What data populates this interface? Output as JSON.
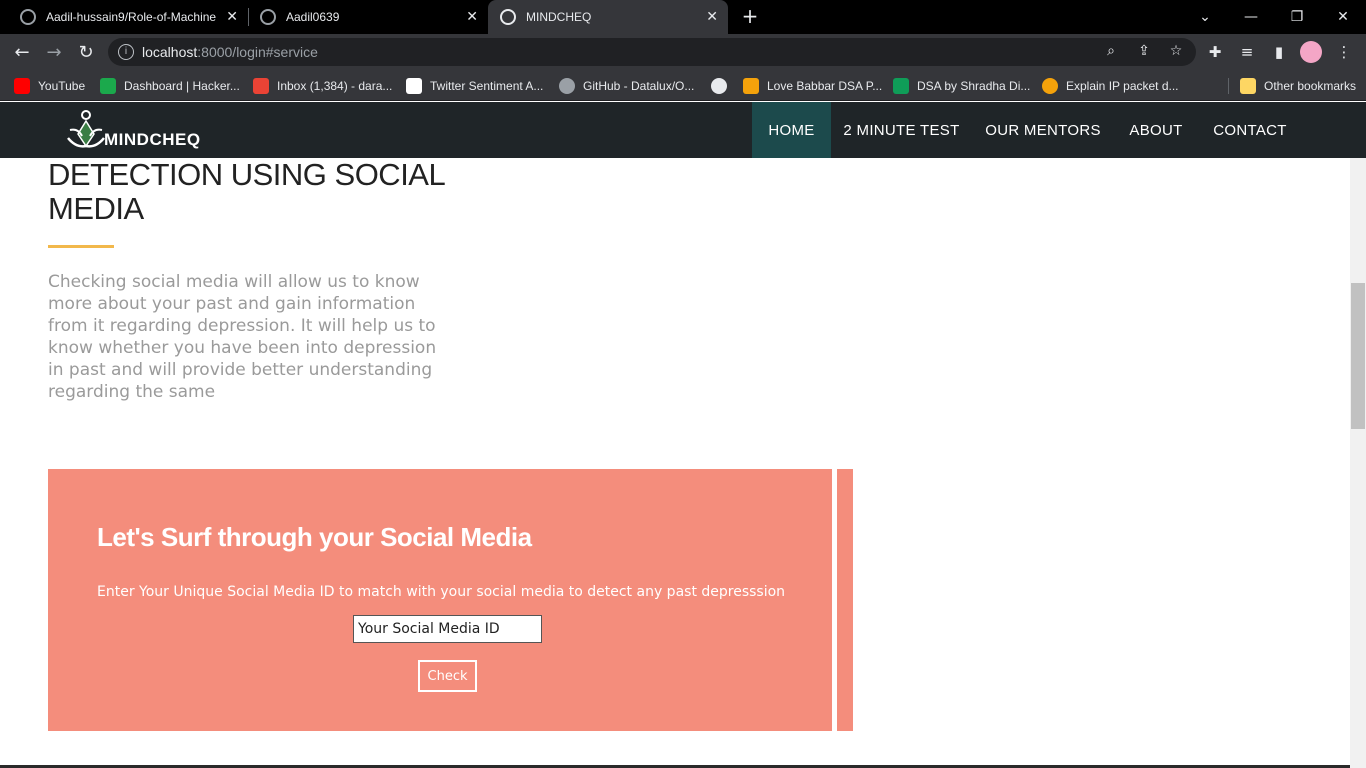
{
  "browser": {
    "tabs": [
      {
        "title": "Aadil-hussain9/Role-of-Machine-",
        "icon": "github-icon"
      },
      {
        "title": "Aadil0639",
        "icon": "github-icon"
      },
      {
        "title": "MINDCHEQ",
        "icon": "globe-icon"
      }
    ],
    "close_glyph": "✕",
    "new_tab_glyph": "+",
    "url_host": "localhost",
    "url_rest": ":8000/login#service",
    "bookmarks": [
      {
        "label": "YouTube",
        "color": "#ff0000"
      },
      {
        "label": "Dashboard | Hacker...",
        "color": "#1ba94c"
      },
      {
        "label": "Inbox (1,384) - dara...",
        "color": "#ea4335"
      },
      {
        "label": "Twitter Sentiment A...",
        "color": "#ffffff"
      },
      {
        "label": "GitHub - Datalux/O...",
        "color": "#9aa0a6"
      },
      {
        "label": "",
        "color": "#e8eaed"
      },
      {
        "label": "Love Babbar DSA P...",
        "color": "#f4a20b"
      },
      {
        "label": "DSA by Shradha Di...",
        "color": "#0f9d58"
      },
      {
        "label": "Explain IP packet d...",
        "color": "#f4a20b"
      }
    ],
    "other_bookmarks": "Other bookmarks"
  },
  "site": {
    "logo_text": "MINDCHEQ",
    "nav": [
      "HOME",
      "2 MINUTE TEST",
      "OUR MENTORS",
      "ABOUT",
      "CONTACT"
    ],
    "active_nav": "HOME",
    "heading_line1": "DETECTION USING SOCIAL",
    "heading_line2": "MEDIA",
    "description": "Checking social media will allow us to know more about your past and gain information from it regarding depression. It will help us to know whether you have been into depression in past and will provide better understanding regarding the same",
    "panel_title": "Let's Surf through your Social Media",
    "panel_subtitle": "Enter Your Unique Social Media ID to match with your social media to detect any past depresssion",
    "input_placeholder": "Your Social Media ID",
    "check_label": "Check"
  },
  "colors": {
    "nav_bg": "#1f2528",
    "nav_active": "#1c4a4c",
    "panel": "#f48d7c",
    "accent_underline": "#f2b84b"
  }
}
